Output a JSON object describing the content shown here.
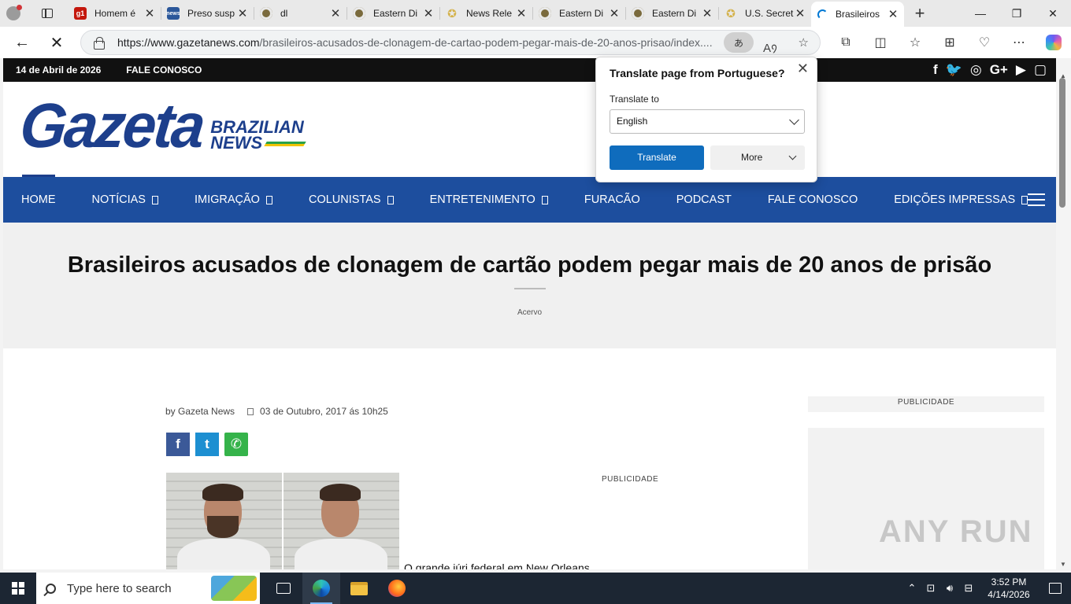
{
  "browser": {
    "tabs": [
      {
        "title": "Homem é",
        "favicon": "g1-icon",
        "favtext": "g1"
      },
      {
        "title": "Preso susp",
        "favicon": "newspaper-icon",
        "favtext": "news"
      },
      {
        "title": "dl",
        "favicon": "seal-icon",
        "favtext": ""
      },
      {
        "title": "Eastern Di",
        "favicon": "seal-icon",
        "favtext": ""
      },
      {
        "title": "News Rele",
        "favicon": "star-icon",
        "favtext": "✪"
      },
      {
        "title": "Eastern Di",
        "favicon": "seal-icon",
        "favtext": ""
      },
      {
        "title": "Eastern Di",
        "favicon": "seal-icon",
        "favtext": ""
      },
      {
        "title": "U.S. Secret",
        "favicon": "star-icon",
        "favtext": "✪"
      },
      {
        "title": "Brasileiros",
        "favicon": "loading-icon",
        "favtext": "",
        "active": true
      }
    ],
    "url_host": "https://www.gazetanews.com",
    "url_path": "/brasileiros-acusados-de-clonagem-de-cartao-podem-pegar-mais-de-20-anos-prisao/index...."
  },
  "site": {
    "date": "14 de Abril de 2026",
    "contact": "FALE CONOSCO",
    "logo_main": "Gazeta",
    "logo_sub1": "BRAZILIAN",
    "logo_sub2": "NEWS",
    "nav": [
      "HOME",
      "NOTÍCIAS",
      "IMIGRAÇÃO",
      "COLUNISTAS",
      "ENTRETENIMENTO",
      "FURACÃO",
      "PODCAST",
      "FALE CONOSCO",
      "EDIÇÕES IMPRESSAS"
    ]
  },
  "article": {
    "title": "Brasileiros acusados de clonagem de cartão podem pegar mais de 20 anos de prisão",
    "category": "Acervo",
    "byline": "by Gazeta News",
    "date": "03 de Outubro, 2017 ás 10h25",
    "first_line": "O grande júri federal em New Orleans",
    "ad_label": "PUBLICIDADE",
    "sidebar_ad_label": "PUBLICIDADE"
  },
  "translate_popup": {
    "title": "Translate page from Portuguese?",
    "label": "Translate to",
    "selected_language": "English",
    "translate_button": "Translate",
    "more_button": "More"
  },
  "watermark": "ANY RUN",
  "taskbar": {
    "search_placeholder": "Type here to search",
    "time": "3:52 PM",
    "date": "4/14/2026"
  }
}
